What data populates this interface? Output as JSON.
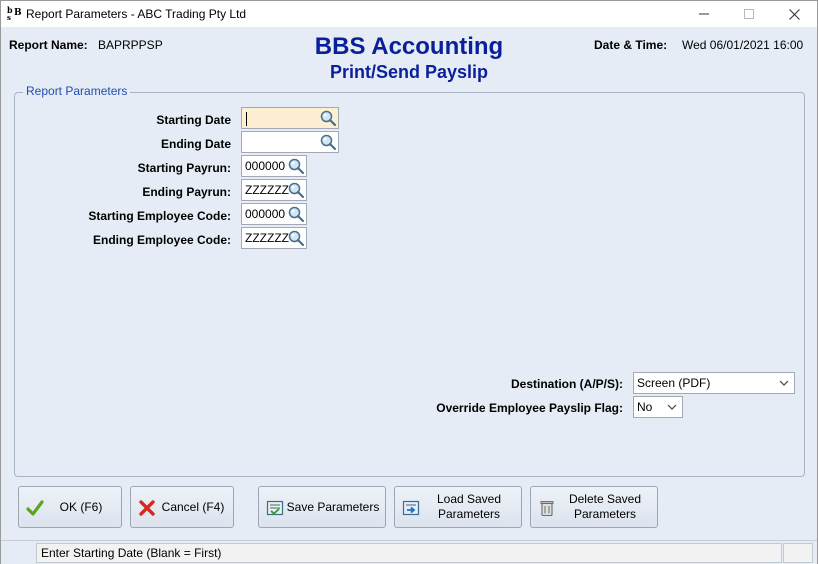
{
  "window": {
    "title": "Report Parameters - ABC Trading Pty Ltd",
    "minimize_glyph": "—",
    "maximize_glyph": "☐",
    "close_glyph": "✕"
  },
  "header": {
    "report_name_label": "Report Name:",
    "report_name_value": "BAPRPPSP",
    "app_title": "BBS Accounting",
    "report_title": "Print/Send Payslip",
    "datetime_label": "Date & Time:",
    "datetime_value": "Wed 06/01/2021 16:00"
  },
  "group": {
    "legend": "Report Parameters"
  },
  "fields": {
    "starting_date": {
      "label": "Starting Date",
      "value": ""
    },
    "ending_date": {
      "label": "Ending Date",
      "value": ""
    },
    "starting_payrun": {
      "label": "Starting Payrun:",
      "value": "000000"
    },
    "ending_payrun": {
      "label": "Ending Payrun:",
      "value": "ZZZZZZ"
    },
    "starting_employee": {
      "label": "Starting Employee Code:",
      "value": "000000"
    },
    "ending_employee": {
      "label": "Ending Employee Code:",
      "value": "ZZZZZZ"
    },
    "destination": {
      "label": "Destination (A/P/S):",
      "value": "Screen (PDF)"
    },
    "override_flag": {
      "label": "Override Employee Payslip Flag:",
      "value": "No"
    }
  },
  "buttons": {
    "ok": "OK (F6)",
    "cancel": "Cancel (F4)",
    "save": "Save Parameters",
    "load_line1": "Load Saved",
    "load_line2": "Parameters",
    "delete_line1": "Delete Saved",
    "delete_line2": "Parameters"
  },
  "status": {
    "message": "Enter Starting Date (Blank = First)"
  },
  "icons": {
    "lookup": "magnifier-icon",
    "ok": "checkmark-icon",
    "cancel": "red-x-icon",
    "save": "save-parameters-icon",
    "load": "load-parameters-icon",
    "delete": "trash-icon"
  },
  "colors": {
    "title_blue": "#0a1f9a",
    "legend_blue": "#1f4db0",
    "focus_field": "#fdf0d2",
    "window_bg": "#e6ecf5"
  }
}
